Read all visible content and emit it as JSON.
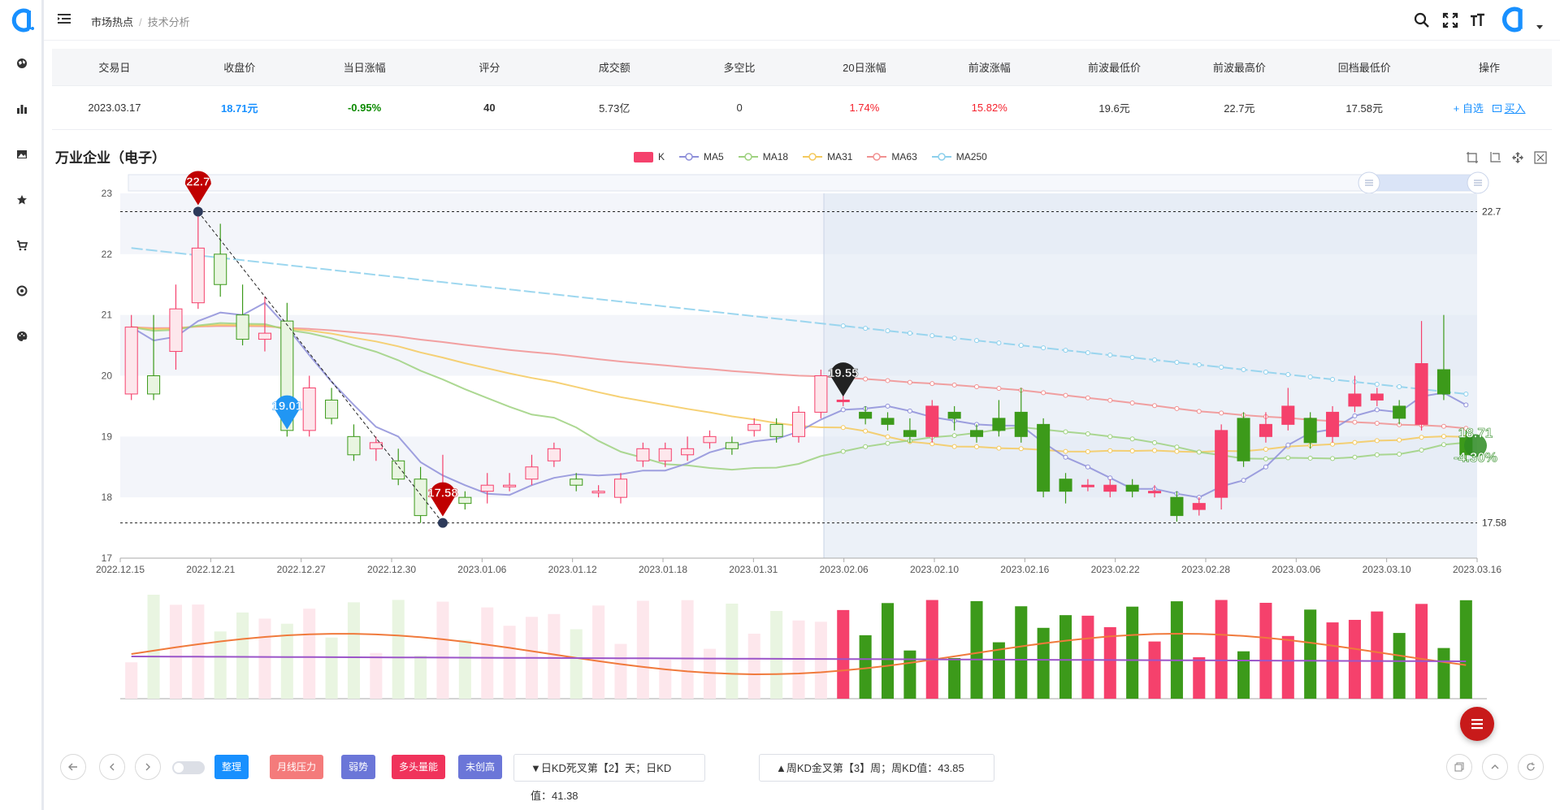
{
  "app": {
    "logo": "brand-logo"
  },
  "rail": {
    "items": [
      "globe-icon",
      "bar-chart-icon",
      "image-icon",
      "star-icon",
      "cart-icon",
      "target-icon",
      "palette-icon"
    ]
  },
  "breadcrumb": {
    "parent": "市场热点",
    "separator": "/",
    "current": "技术分析"
  },
  "summary": {
    "headers": [
      "交易日",
      "收盘价",
      "当日涨幅",
      "评分",
      "成交额",
      "多空比",
      "20日涨幅",
      "前波涨幅",
      "前波最低价",
      "前波最高价",
      "回档最低价",
      "操作"
    ],
    "row": {
      "date": "2023.03.17",
      "close": "18.71元",
      "change": "-0.95%",
      "score": "40",
      "turnover": "5.73亿",
      "ratio": "0",
      "change20": "1.74%",
      "prev_wave": "15.82%",
      "prev_low": "19.6元",
      "prev_high": "22.7元",
      "pullback_low": "17.58元",
      "add_watch": "+ 自选",
      "buy": "买入"
    }
  },
  "stock": {
    "title": "万业企业（电子）"
  },
  "legend": [
    "K",
    "MA5",
    "MA18",
    "MA31",
    "MA63",
    "MA250"
  ],
  "chart_data": {
    "type": "candlestick",
    "title": "万业企业（电子）",
    "ylim": [
      17,
      23
    ],
    "y_ticks": [
      "23",
      "22",
      "21",
      "20",
      "19",
      "18",
      "17"
    ],
    "x_ticks": [
      "2022.12.15",
      "2022.12.21",
      "2022.12.27",
      "2022.12.30",
      "2023.01.06",
      "2023.01.12",
      "2023.01.18",
      "2023.01.31",
      "2023.02.06",
      "2023.02.10",
      "2023.02.16",
      "2023.02.22",
      "2023.02.28",
      "2023.03.06",
      "2023.03.10",
      "2023.03.16"
    ],
    "ref_lines": [
      {
        "value": 22.7,
        "label": "22.7"
      },
      {
        "value": 17.58,
        "label": "17.58"
      }
    ],
    "markers": [
      {
        "label": "22.7",
        "color": "#c00000",
        "index": 3,
        "value": 22.7
      },
      {
        "label": "19.01",
        "color": "#2196f3",
        "index": 7,
        "value": 19.01
      },
      {
        "label": "17.58",
        "color": "#c00000",
        "index": 14,
        "value": 17.58
      },
      {
        "label": "19.55",
        "color": "#222222",
        "index": 32,
        "value": 19.55
      }
    ],
    "last_price": {
      "value": "18.71",
      "change": "-4.30%"
    },
    "candles": [
      [
        19.7,
        20.8,
        19.6,
        21.0
      ],
      [
        20.0,
        19.7,
        19.6,
        21.0
      ],
      [
        20.4,
        21.1,
        20.1,
        21.5
      ],
      [
        21.2,
        22.1,
        21.1,
        22.7
      ],
      [
        22.0,
        21.5,
        21.3,
        22.5
      ],
      [
        21.0,
        20.6,
        20.5,
        21.5
      ],
      [
        20.6,
        20.7,
        20.4,
        21.3
      ],
      [
        20.9,
        19.1,
        19.0,
        21.2
      ],
      [
        19.1,
        19.8,
        19.0,
        20.0
      ],
      [
        19.6,
        19.3,
        19.2,
        19.8
      ],
      [
        19.0,
        18.7,
        18.6,
        19.2
      ],
      [
        18.8,
        18.9,
        18.6,
        19.0
      ],
      [
        18.6,
        18.3,
        18.2,
        18.8
      ],
      [
        18.3,
        17.7,
        17.58,
        18.5
      ],
      [
        17.9,
        18.2,
        17.7,
        18.7
      ],
      [
        18.0,
        17.9,
        17.8,
        18.1
      ],
      [
        18.1,
        18.2,
        17.9,
        18.4
      ],
      [
        18.2,
        18.2,
        18.1,
        18.4
      ],
      [
        18.3,
        18.5,
        18.2,
        18.7
      ],
      [
        18.6,
        18.8,
        18.5,
        18.9
      ],
      [
        18.3,
        18.2,
        18.1,
        18.4
      ],
      [
        18.1,
        18.1,
        18.0,
        18.2
      ],
      [
        18.0,
        18.3,
        17.9,
        18.4
      ],
      [
        18.6,
        18.8,
        18.5,
        18.9
      ],
      [
        18.6,
        18.8,
        18.5,
        18.9
      ],
      [
        18.7,
        18.8,
        18.6,
        19.0
      ],
      [
        18.9,
        19.0,
        18.8,
        19.1
      ],
      [
        18.9,
        18.8,
        18.7,
        19.0
      ],
      [
        19.1,
        19.2,
        19.0,
        19.3
      ],
      [
        19.2,
        19.0,
        18.9,
        19.3
      ],
      [
        19.0,
        19.4,
        18.9,
        19.5
      ],
      [
        19.4,
        20.0,
        19.3,
        20.1
      ],
      [
        19.6,
        19.6,
        19.5,
        19.7
      ],
      [
        19.4,
        19.3,
        19.2,
        19.5
      ],
      [
        19.3,
        19.2,
        19.1,
        19.4
      ],
      [
        19.1,
        19.0,
        18.9,
        19.3
      ],
      [
        19.0,
        19.5,
        18.9,
        19.6
      ],
      [
        19.4,
        19.3,
        19.1,
        19.5
      ],
      [
        19.1,
        19.0,
        18.9,
        19.2
      ],
      [
        19.3,
        19.1,
        19.0,
        19.6
      ],
      [
        19.4,
        19.0,
        18.9,
        19.8
      ],
      [
        19.2,
        18.1,
        18.0,
        19.3
      ],
      [
        18.3,
        18.1,
        17.9,
        18.4
      ],
      [
        18.2,
        18.2,
        18.1,
        18.3
      ],
      [
        18.1,
        18.2,
        18.0,
        18.3
      ],
      [
        18.2,
        18.1,
        18.0,
        18.3
      ],
      [
        18.1,
        18.1,
        18.0,
        18.2
      ],
      [
        18.0,
        17.7,
        17.6,
        18.1
      ],
      [
        17.8,
        17.9,
        17.7,
        18.0
      ],
      [
        18.0,
        19.1,
        17.8,
        19.2
      ],
      [
        19.3,
        18.6,
        18.5,
        19.4
      ],
      [
        19.0,
        19.2,
        18.9,
        19.4
      ],
      [
        19.2,
        19.5,
        19.1,
        19.8
      ],
      [
        19.3,
        18.9,
        18.8,
        19.4
      ],
      [
        19.0,
        19.4,
        18.9,
        19.5
      ],
      [
        19.5,
        19.7,
        19.4,
        20.0
      ],
      [
        19.6,
        19.7,
        19.5,
        19.8
      ],
      [
        19.5,
        19.3,
        19.2,
        19.6
      ],
      [
        19.2,
        20.2,
        19.1,
        20.9
      ],
      [
        20.1,
        19.7,
        19.6,
        21.0
      ],
      [
        19.0,
        18.7,
        18.6,
        19.1
      ]
    ]
  },
  "bottom": {
    "tags": [
      "整理",
      "月线压力",
      "弱势",
      "多头量能",
      "未创高"
    ],
    "daily_kd": "▼日KD死叉第【2】天；日KD值：41.38",
    "weekly_kd": "▲周KD金叉第【3】周；周KD值：43.85"
  },
  "colors": {
    "up": "#f5416c",
    "down": "#3c9a1a",
    "accent": "#1890ff",
    "ma5": "#8e8fd9",
    "ma18": "#9ed17f",
    "ma31": "#f4c95d",
    "ma63": "#f19191",
    "ma250": "#8cd0ec"
  }
}
